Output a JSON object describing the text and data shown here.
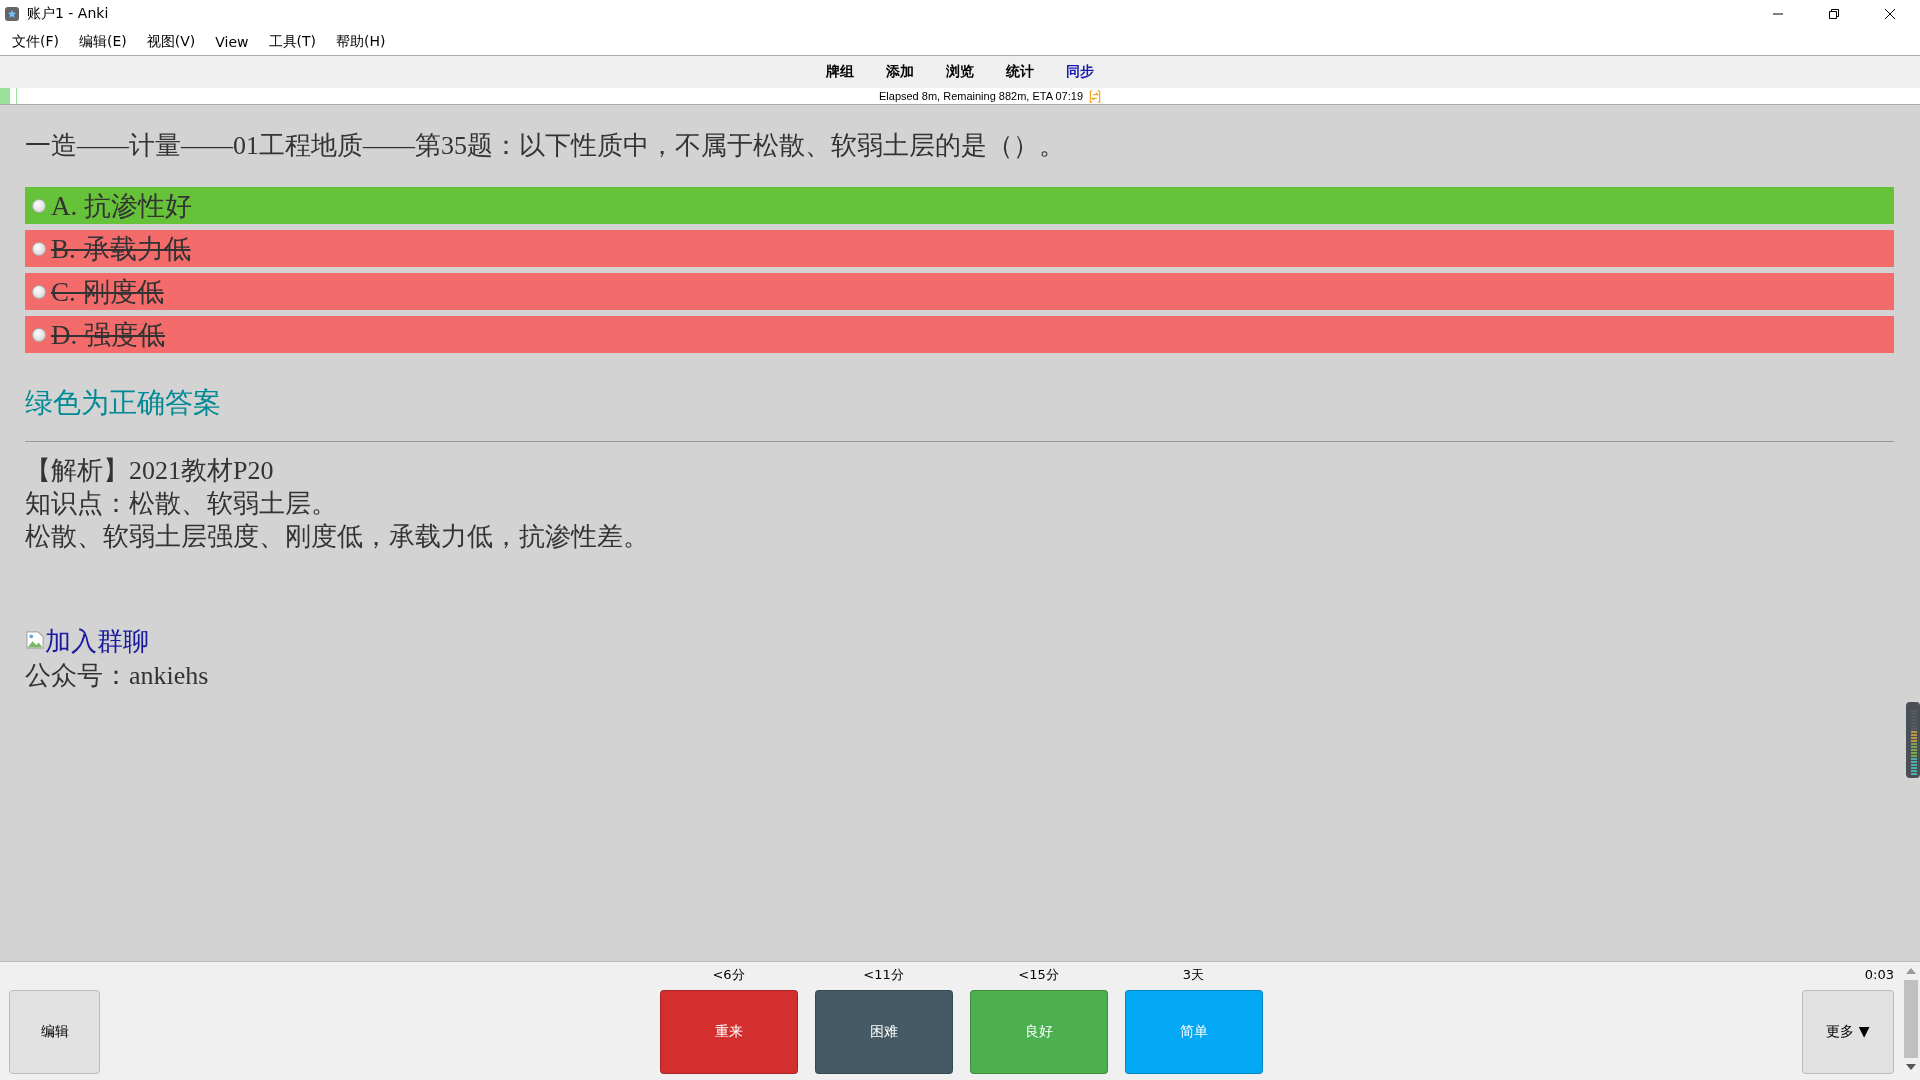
{
  "window": {
    "title": "账户1 - Anki"
  },
  "menu": [
    "文件(F)",
    "编辑(E)",
    "视图(V)",
    "View",
    "工具(T)",
    "帮助(H)"
  ],
  "toolbar": [
    {
      "label": "牌组",
      "highlighted": false
    },
    {
      "label": "添加",
      "highlighted": false
    },
    {
      "label": "浏览",
      "highlighted": false
    },
    {
      "label": "统计",
      "highlighted": false
    },
    {
      "label": "同步",
      "highlighted": true
    }
  ],
  "progress": {
    "text": "Elapsed 8m, Remaining 882m, ETA 07:19"
  },
  "card": {
    "question": "一造——计量——01工程地质——第35题：以下性质中，不属于松散、软弱土层的是（）。",
    "options": [
      {
        "label": "A. 抗渗性好",
        "correct": true
      },
      {
        "label": "B. 承载力低",
        "correct": false
      },
      {
        "label": "C. 刚度低",
        "correct": false
      },
      {
        "label": "D. 强度低",
        "correct": false
      }
    ],
    "hint": "绿色为正确答案",
    "explanation": [
      "【解析】2021教材P20",
      "知识点：松散、软弱土层。",
      "松散、软弱土层强度、刚度低，承载力低，抗渗性差。"
    ],
    "link": "加入群聊",
    "footer": "公众号：ankiehs"
  },
  "bottom_bar": {
    "edit": "编辑",
    "answers": [
      {
        "interval": "<6分",
        "label": "重来",
        "color": "#d32f2f"
      },
      {
        "interval": "<11分",
        "label": "困难",
        "color": "#455a64"
      },
      {
        "interval": "<15分",
        "label": "良好",
        "color": "#4caf50"
      },
      {
        "interval": "3天",
        "label": "简单",
        "color": "#03a9f4"
      }
    ],
    "more": "更多 ▼",
    "timer": "0:03"
  }
}
